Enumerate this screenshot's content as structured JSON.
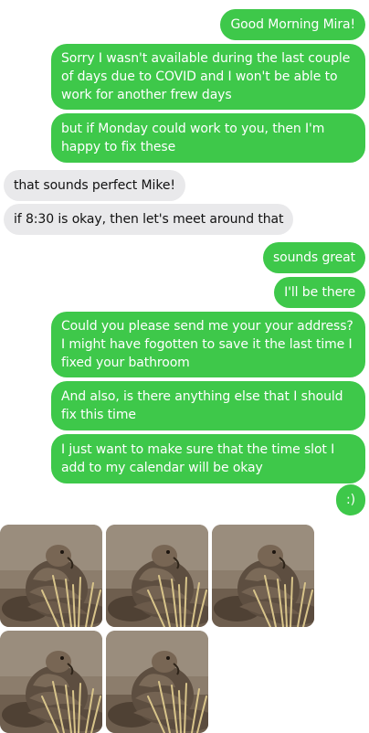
{
  "messages": [
    {
      "from": "me",
      "text": "Good Morning Mira!"
    },
    {
      "from": "me",
      "text": "Sorry I wasn't available during the last couple of days due to COVID and I won't be able to work for another frew days"
    },
    {
      "from": "me",
      "text": "but if Monday could work to you, then I'm happy to fix these"
    },
    {
      "from": "them",
      "text": "that sounds perfect Mike!"
    },
    {
      "from": "them",
      "text": "if 8:30 is okay, then let's meet around that"
    },
    {
      "from": "me",
      "text": "sounds great"
    },
    {
      "from": "me",
      "text": "I'll be there"
    },
    {
      "from": "me",
      "text": "Could you please send me your your address? I might have fogotten to save it the last time I fixed your bathroom"
    },
    {
      "from": "me",
      "text": "And also, is there anything else that I should fix this time"
    },
    {
      "from": "me",
      "text": "I just want to make sure that the time slot I add to my calendar will be okay"
    },
    {
      "from": "me",
      "text": ":)"
    }
  ],
  "colors": {
    "outgoing_bubble": "#3ec84a",
    "incoming_bubble": "#e9e9eb"
  },
  "attachments": {
    "count": 5,
    "subject": "pangolin-photo"
  }
}
